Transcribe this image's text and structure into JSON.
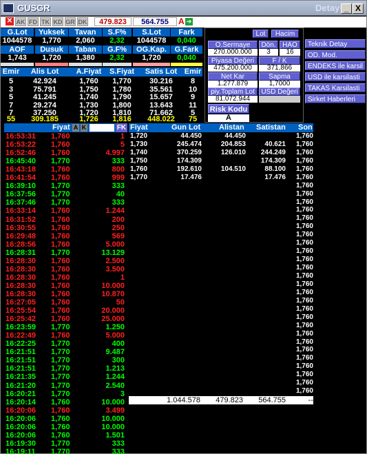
{
  "window": {
    "title": "GUSGR",
    "detay": "Detay",
    "minimize": "_",
    "close": "X"
  },
  "toolbar": {
    "tabs": [
      "AK",
      "FD",
      "TK",
      "KD",
      "GR",
      "DK"
    ],
    "value1": "479.823",
    "value2": "564.755",
    "a_label": "A"
  },
  "summary": {
    "row1_headers": [
      "G.Lot",
      "Yuksek",
      "Tavan",
      "S.F%",
      "S.Lot",
      "Fark"
    ],
    "row1_values": [
      "1044578",
      "1,770",
      "2,060",
      "2,32",
      "1044578",
      "0,040"
    ],
    "row2_headers": [
      "AOF",
      "Dusuk",
      "Taban",
      "G.F%",
      "OG.Kap.",
      "G.Fark"
    ],
    "row2_values": [
      "1,743",
      "1,720",
      "1,380",
      "2,32",
      "1,720",
      "0,040"
    ]
  },
  "orderbook": {
    "headers": [
      "Emir",
      "Alis Lot",
      "A.Fiyat",
      "S.Fiyat",
      "Satis Lot",
      "Emir"
    ],
    "rows": [
      [
        "5",
        "42.924",
        "1,760",
        "1,770",
        "30.216",
        "8"
      ],
      [
        "3",
        "75.791",
        "1,750",
        "1,780",
        "35.561",
        "10"
      ],
      [
        "5",
        "41.245",
        "1,740",
        "1,790",
        "15.657",
        "9"
      ],
      [
        "7",
        "29.274",
        "1,730",
        "1,800",
        "13.643",
        "11"
      ],
      [
        "7",
        "37.250",
        "1,720",
        "1,810",
        "71.662",
        "5"
      ]
    ],
    "total": [
      "55",
      "309.185",
      "1,726",
      "1,816",
      "448.022",
      "75"
    ]
  },
  "panel": {
    "lot": "Lot",
    "hacim": "Hacim",
    "o_sermaye_label": "O.Sermaye",
    "o_sermaye_value": "270.000.000",
    "don_label": "Dön.",
    "don_value": "3",
    "hao_label": "HAO",
    "hao_value": "16",
    "piyasa_label": "Piyasa Değeri",
    "piyasa_value": "475.200.000",
    "fk_label": "F / K",
    "fk_value": "371,866",
    "net_kar_label": "Net Kar",
    "net_kar_value": "1.277.879",
    "sapma_label": "Sapma",
    "sapma_value": "1,7000",
    "piy_toplam_label": "piy.Toplam Lot",
    "piy_toplam_value": "81.072.944",
    "usd_degeri_label": "USD Değeri",
    "risk_kodu_label": "Risk Kodu",
    "risk_kodu_value": "A"
  },
  "side_buttons": [
    "Teknik Detay",
    "OD. Mod.",
    "ENDEKS ile karsil",
    "USD ile karsilasti",
    "TAKAS Karsilasti",
    "Sirket Haberleri"
  ],
  "trades": {
    "headers": {
      "fiyat": "Fiyat",
      "a": "A",
      "k": "K",
      "fk": "FK"
    },
    "rows": [
      {
        "time": "16:53:31",
        "price": "1,760",
        "lot": "1",
        "c": "red"
      },
      {
        "time": "16:53:22",
        "price": "1,760",
        "lot": "5",
        "c": "red"
      },
      {
        "time": "16:52:46",
        "price": "1,760",
        "lot": "4.997",
        "c": "red"
      },
      {
        "time": "16:45:40",
        "price": "1,770",
        "lot": "333",
        "c": "green"
      },
      {
        "time": "16:43:18",
        "price": "1,760",
        "lot": "800",
        "c": "red"
      },
      {
        "time": "16:41:54",
        "price": "1,760",
        "lot": "999",
        "c": "red"
      },
      {
        "time": "16:39:10",
        "price": "1,770",
        "lot": "333",
        "c": "green"
      },
      {
        "time": "16:37:56",
        "price": "1,770",
        "lot": "40",
        "c": "green"
      },
      {
        "time": "16:37:46",
        "price": "1,770",
        "lot": "333",
        "c": "green"
      },
      {
        "time": "16:33:14",
        "price": "1,760",
        "lot": "1.244",
        "c": "red"
      },
      {
        "time": "16:31:52",
        "price": "1,760",
        "lot": "200",
        "c": "red"
      },
      {
        "time": "16:30:55",
        "price": "1,760",
        "lot": "250",
        "c": "red"
      },
      {
        "time": "16:29:48",
        "price": "1,760",
        "lot": "569",
        "c": "red"
      },
      {
        "time": "16:28:56",
        "price": "1,760",
        "lot": "5.000",
        "c": "red"
      },
      {
        "time": "16:28:31",
        "price": "1,770",
        "lot": "13.129",
        "c": "green"
      },
      {
        "time": "16:28:30",
        "price": "1,760",
        "lot": "2.500",
        "c": "red"
      },
      {
        "time": "16:28:30",
        "price": "1,760",
        "lot": "3.500",
        "c": "red"
      },
      {
        "time": "16:28:30",
        "price": "1,760",
        "lot": "1",
        "c": "red"
      },
      {
        "time": "16:28:30",
        "price": "1,760",
        "lot": "10.000",
        "c": "red"
      },
      {
        "time": "16:28:30",
        "price": "1,760",
        "lot": "10.870",
        "c": "red"
      },
      {
        "time": "16:27:05",
        "price": "1,760",
        "lot": "50",
        "c": "red"
      },
      {
        "time": "16:25:54",
        "price": "1,760",
        "lot": "20.000",
        "c": "red"
      },
      {
        "time": "16:25:42",
        "price": "1,760",
        "lot": "25.000",
        "c": "red"
      },
      {
        "time": "16:23:59",
        "price": "1,770",
        "lot": "1.250",
        "c": "green"
      },
      {
        "time": "16:22:49",
        "price": "1,760",
        "lot": "5.000",
        "c": "red"
      },
      {
        "time": "16:22:25",
        "price": "1,770",
        "lot": "400",
        "c": "green"
      },
      {
        "time": "16:21:51",
        "price": "1,770",
        "lot": "9.487",
        "c": "green"
      },
      {
        "time": "16:21:51",
        "price": "1,770",
        "lot": "300",
        "c": "green"
      },
      {
        "time": "16:21:51",
        "price": "1,770",
        "lot": "1.213",
        "c": "green"
      },
      {
        "time": "16:21:35",
        "price": "1,770",
        "lot": "1.244",
        "c": "green"
      },
      {
        "time": "16:21:20",
        "price": "1,770",
        "lot": "2.540",
        "c": "green"
      },
      {
        "time": "16:20:21",
        "price": "1,770",
        "lot": "3",
        "c": "green"
      },
      {
        "time": "16:20:14",
        "price": "1,760",
        "lot": "10.000",
        "c": "green"
      },
      {
        "time": "16:20:06",
        "price": "1,760",
        "lot": "3.499",
        "c": "red"
      },
      {
        "time": "16:20:06",
        "price": "1,760",
        "lot": "10.000",
        "c": "green"
      },
      {
        "time": "16:20:06",
        "price": "1,760",
        "lot": "10.000",
        "c": "green"
      },
      {
        "time": "16:20:06",
        "price": "1,760",
        "lot": "1.501",
        "c": "green"
      },
      {
        "time": "16:19:30",
        "price": "1,770",
        "lot": "333",
        "c": "green"
      },
      {
        "time": "16:19:11",
        "price": "1,770",
        "lot": "333",
        "c": "green"
      }
    ]
  },
  "depth": {
    "headers": [
      "Fiyat",
      "Gun Lot",
      "Alistan",
      "Satistan",
      "Son"
    ],
    "rows": [
      [
        "1,720",
        "44.450",
        "44.450",
        ""
      ],
      [
        "1,730",
        "245.474",
        "204.853",
        "40.621"
      ],
      [
        "1,740",
        "370.259",
        "126.010",
        "244.249"
      ],
      [
        "1,750",
        "174.309",
        "",
        "174.309"
      ],
      [
        "1,760",
        "192.610",
        "104.510",
        "88.100"
      ],
      [
        "1,770",
        "17.476",
        "",
        "17.476"
      ]
    ],
    "son_value": "1,760",
    "totals": [
      "1.044.578",
      "479.823",
      "564.755",
      "--"
    ]
  },
  "colors": {
    "red": "#ff2020",
    "green": "#00ff00",
    "header_blue": "#0060c0",
    "panel_purple": "#6060d0"
  }
}
